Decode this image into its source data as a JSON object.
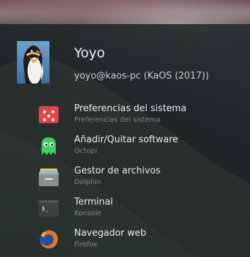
{
  "user": {
    "name": "Yoyo",
    "host": "yoyo@kaos-pc (KaOS (2017))"
  },
  "favorites": [
    {
      "title": "Preferencias del sistema",
      "subtitle": "Preferencias del sistema",
      "icon": "system-settings-icon",
      "color": "#e5434b"
    },
    {
      "title": "Añadir/Quitar software",
      "subtitle": "Octopi",
      "icon": "octopi-ghost-icon",
      "color": "#3fcf60"
    },
    {
      "title": "Gestor de archivos",
      "subtitle": "Dolphin",
      "icon": "file-manager-icon",
      "color": "#8a9092"
    },
    {
      "title": "Terminal",
      "subtitle": "Konsole",
      "icon": "terminal-icon",
      "color": "#3d4143"
    },
    {
      "title": "Navegador web",
      "subtitle": "Firefox",
      "icon": "firefox-icon",
      "color": "#e8762d"
    }
  ]
}
